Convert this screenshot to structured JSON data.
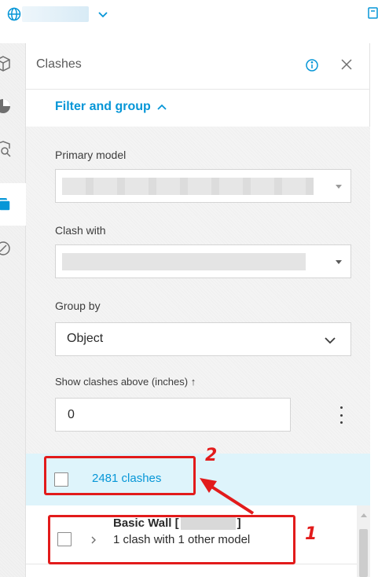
{
  "panel": {
    "title": "Clashes",
    "filter_header": "Filter and group"
  },
  "filters": {
    "primary_model_label": "Primary model",
    "clash_with_label": "Clash with",
    "group_by_label": "Group by",
    "group_by_value": "Object",
    "threshold_label": "Show clashes above (inches) ↑",
    "threshold_value": "0"
  },
  "summary": {
    "label": "2481 clashes"
  },
  "results": [
    {
      "title_prefix": "Basic Wall [",
      "title_suffix": "]",
      "subtitle": "1 clash with 1 other model"
    }
  ],
  "annotations": {
    "marker_1": "1",
    "marker_2": "2",
    "color": "#e21b1b"
  },
  "colors": {
    "accent": "#0696d7",
    "summary_bg": "#def4fb",
    "filter_bg": "#f4f4f4"
  },
  "icons": {
    "top_left": "globe-icon",
    "top_right": "export-icon",
    "rail": [
      "model-cube-icon",
      "pie-chart-icon",
      "search-doc-icon",
      "clash-icon",
      "check-circle-icon"
    ]
  }
}
